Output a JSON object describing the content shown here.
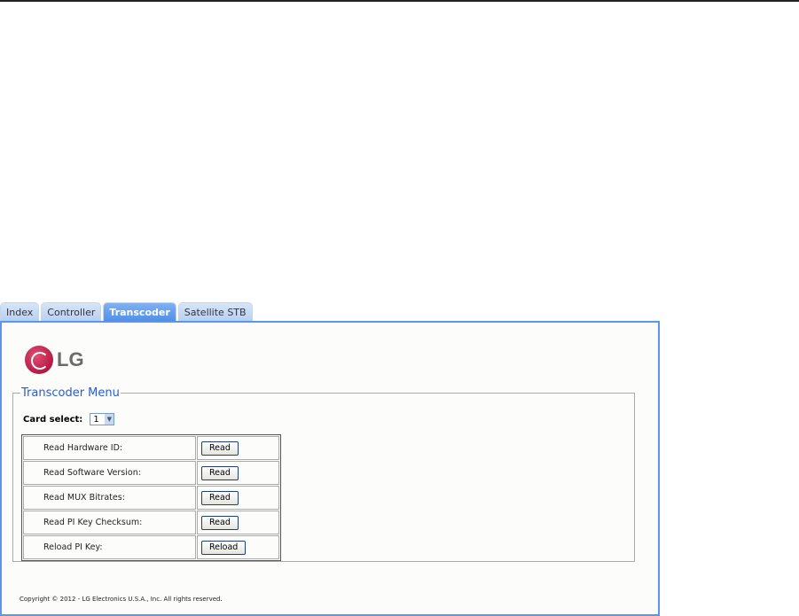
{
  "tabs": [
    {
      "label": "Index"
    },
    {
      "label": "Controller"
    },
    {
      "label": "Transcoder"
    },
    {
      "label": "Satellite STB"
    }
  ],
  "logo": {
    "text": "LG"
  },
  "menu": {
    "title": "Transcoder Menu",
    "card_label": "Card select:",
    "card_value": "1"
  },
  "rows": [
    {
      "label": "Read Hardware ID:",
      "button": "Read"
    },
    {
      "label": "Read Software Version:",
      "button": "Read"
    },
    {
      "label": "Read MUX Bitrates:",
      "button": "Read"
    },
    {
      "label": "Read PI Key Checksum:",
      "button": "Read"
    },
    {
      "label": "Reload PI Key:",
      "button": "Reload"
    }
  ],
  "footer": {
    "copyright": "Copyright © 2012 - LG Electronics U.S.A., Inc. All rights reserved."
  }
}
